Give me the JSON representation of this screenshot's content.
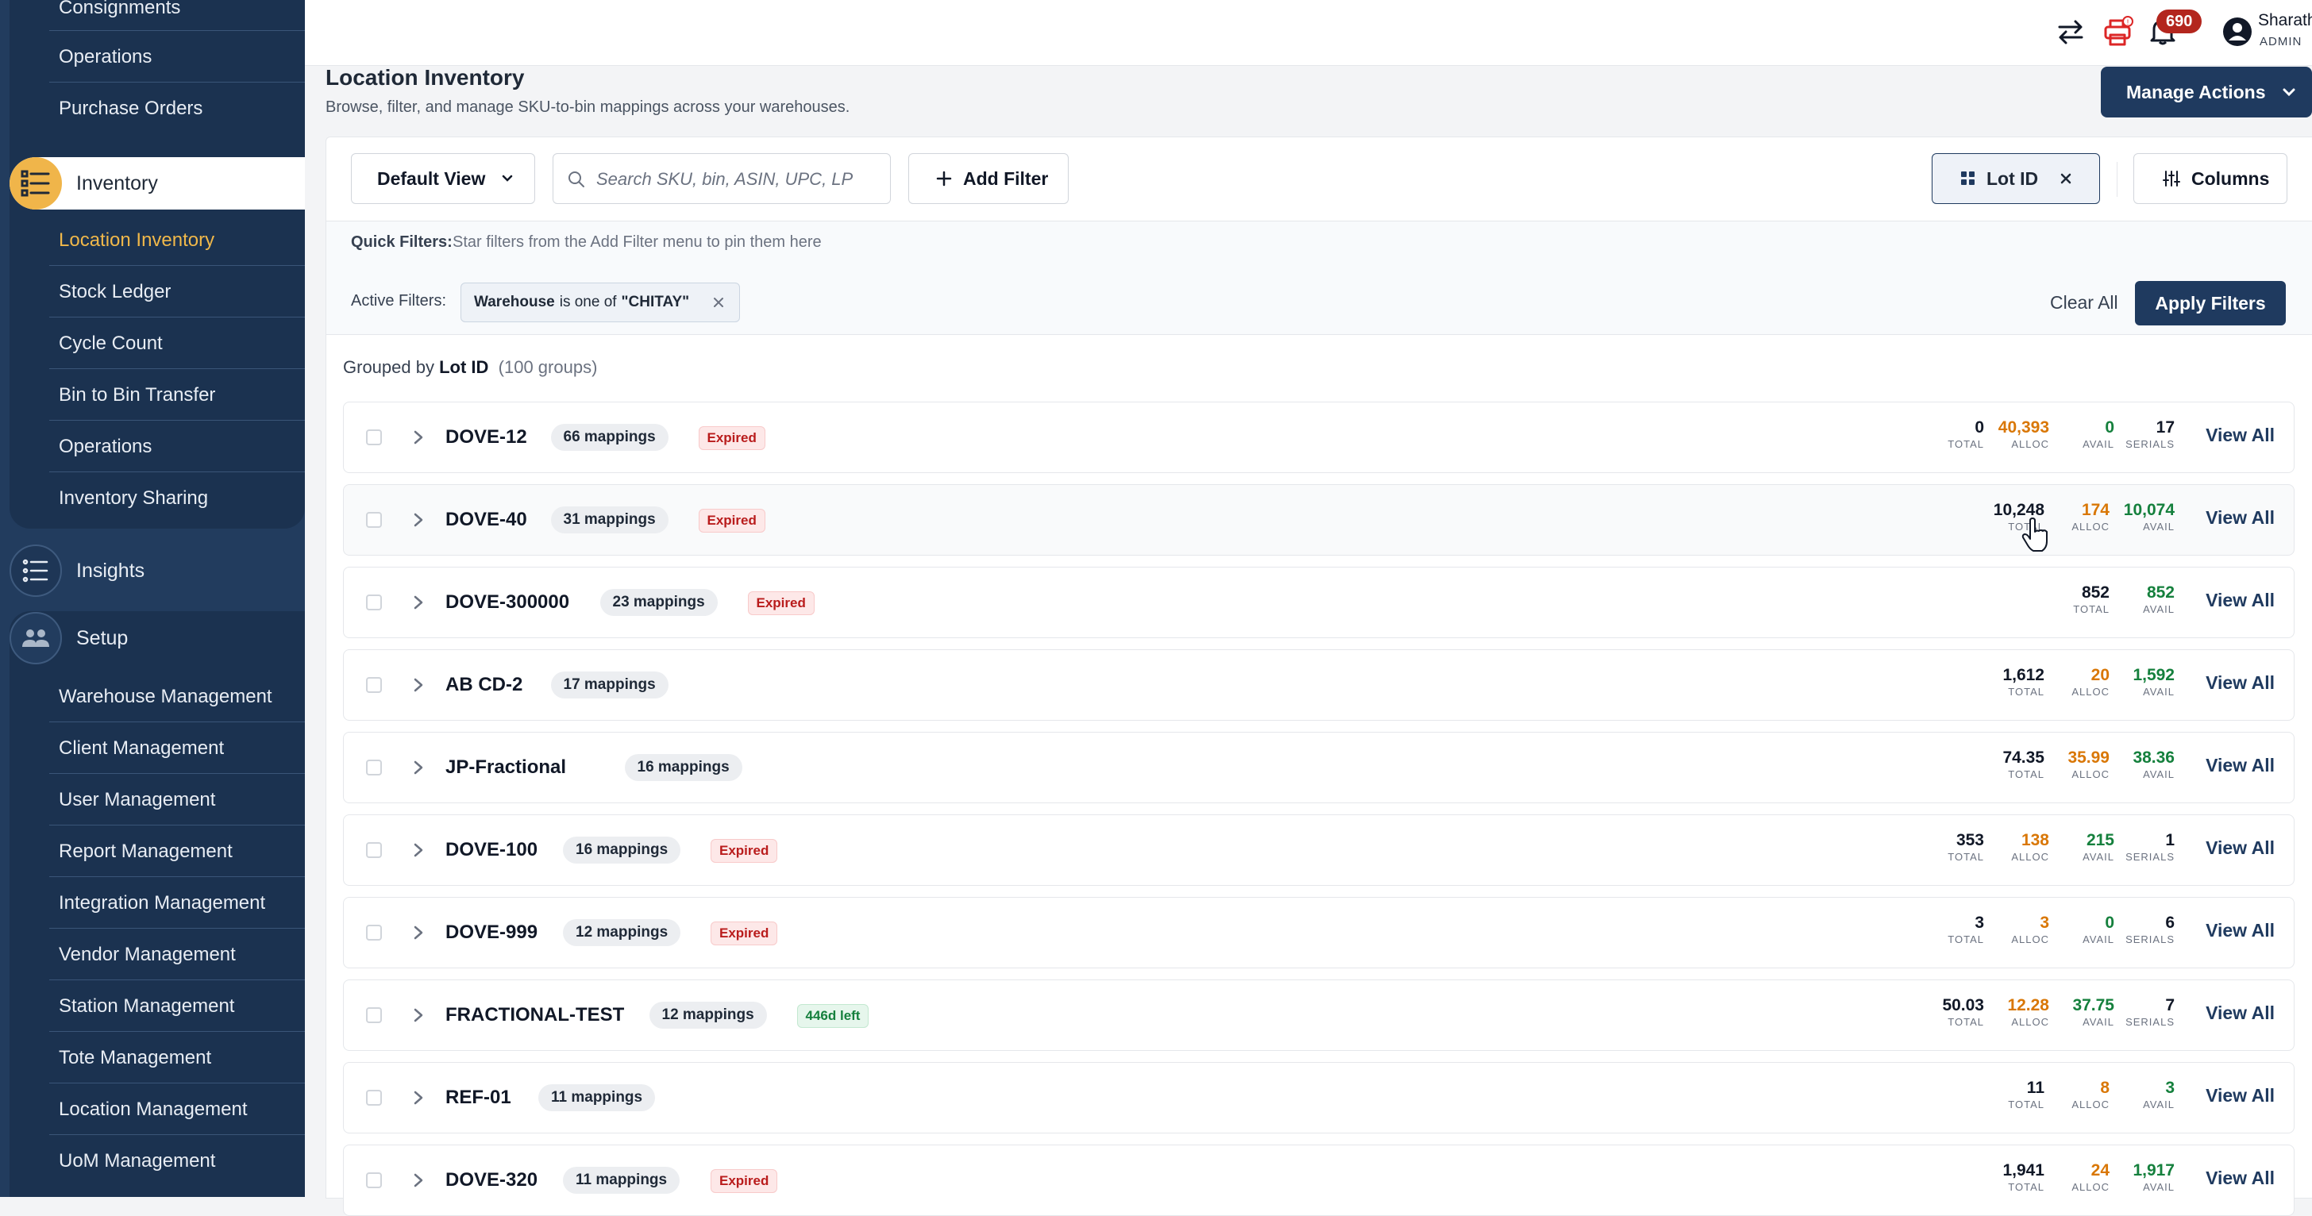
{
  "sidebar": {
    "operations_items_top": [
      "Consignments",
      "Operations",
      "Purchase Orders"
    ],
    "inventory": {
      "label": "Inventory",
      "items": [
        "Location Inventory",
        "Stock Ledger",
        "Cycle Count",
        "Bin to Bin Transfer",
        "Operations",
        "Inventory Sharing"
      ],
      "active_item": "Location Inventory"
    },
    "insights": {
      "label": "Insights"
    },
    "setup": {
      "label": "Setup",
      "items": [
        "Warehouse Management",
        "Client Management",
        "User Management",
        "Report Management",
        "Integration Management",
        "Vendor Management",
        "Station Management",
        "Tote Management",
        "Location Management",
        "UoM Management"
      ]
    },
    "accent_color": "#f0b54a"
  },
  "topbar": {
    "notification_count": "690",
    "user_name": "Sharath",
    "user_role": "ADMIN",
    "icons": [
      "swap-icon",
      "printer-alert-icon",
      "bell-icon",
      "user-avatar-icon"
    ]
  },
  "page": {
    "title": "Location Inventory",
    "subtitle": "Browse, filter, and manage SKU-to-bin mappings across your warehouses.",
    "manage_actions_label": "Manage Actions"
  },
  "toolbar": {
    "view_label": "Default View",
    "search_placeholder": "Search SKU, bin, ASIN, UPC, LP",
    "add_filter_label": "Add Filter",
    "group_chip_label": "Lot ID",
    "columns_label": "Columns"
  },
  "filters": {
    "quick_label": "Quick Filters:",
    "quick_hint": "Star filters from the Add Filter menu to pin them here",
    "active_label": "Active Filters:",
    "active_chip": {
      "field": "Warehouse",
      "op": "is one of",
      "value": "\"CHITAY\""
    },
    "clear_all_label": "Clear All",
    "apply_label": "Apply Filters"
  },
  "grouping": {
    "prefix": "Grouped by",
    "field": "Lot ID",
    "count_text": "(100 groups)"
  },
  "stat_labels": {
    "total": "TOTAL",
    "alloc": "ALLOC",
    "avail": "AVAIL",
    "serials": "SERIALS"
  },
  "view_all_label": "View All",
  "groups": [
    {
      "name": "DOVE-12",
      "mappings": "66 mappings",
      "tag": "Expired",
      "tag_type": "expired",
      "total": "0",
      "alloc": "40,393",
      "avail": "0",
      "serials": "17"
    },
    {
      "name": "DOVE-40",
      "mappings": "31 mappings",
      "tag": "Expired",
      "tag_type": "expired",
      "total": "10,248",
      "alloc": "174",
      "avail": "10,074",
      "serials": null
    },
    {
      "name": "DOVE-300000",
      "mappings": "23 mappings",
      "tag": "Expired",
      "tag_type": "expired",
      "total": "852",
      "alloc": null,
      "avail": "852",
      "serials": null
    },
    {
      "name": "AB CD-2",
      "mappings": "17 mappings",
      "tag": null,
      "tag_type": null,
      "total": "1,612",
      "alloc": "20",
      "avail": "1,592",
      "serials": null
    },
    {
      "name": "JP-Fractional",
      "mappings": "16 mappings",
      "tag": null,
      "tag_type": null,
      "total": "74.35",
      "alloc": "35.99",
      "avail": "38.36",
      "serials": null
    },
    {
      "name": "DOVE-100",
      "mappings": "16 mappings",
      "tag": "Expired",
      "tag_type": "expired",
      "total": "353",
      "alloc": "138",
      "avail": "215",
      "serials": "1"
    },
    {
      "name": "DOVE-999",
      "mappings": "12 mappings",
      "tag": "Expired",
      "tag_type": "expired",
      "total": "3",
      "alloc": "3",
      "avail": "0",
      "serials": "6"
    },
    {
      "name": "FRACTIONAL-TEST",
      "mappings": "12 mappings",
      "tag": "446d left",
      "tag_type": "left",
      "total": "50.03",
      "alloc": "12.28",
      "avail": "37.75",
      "serials": "7"
    },
    {
      "name": "REF-01",
      "mappings": "11 mappings",
      "tag": null,
      "tag_type": null,
      "total": "11",
      "alloc": "8",
      "avail": "3",
      "serials": null
    },
    {
      "name": "DOVE-320",
      "mappings": "11 mappings",
      "tag": "Expired",
      "tag_type": "expired",
      "total": "1,941",
      "alloc": "24",
      "avail": "1,917",
      "serials": null
    }
  ]
}
